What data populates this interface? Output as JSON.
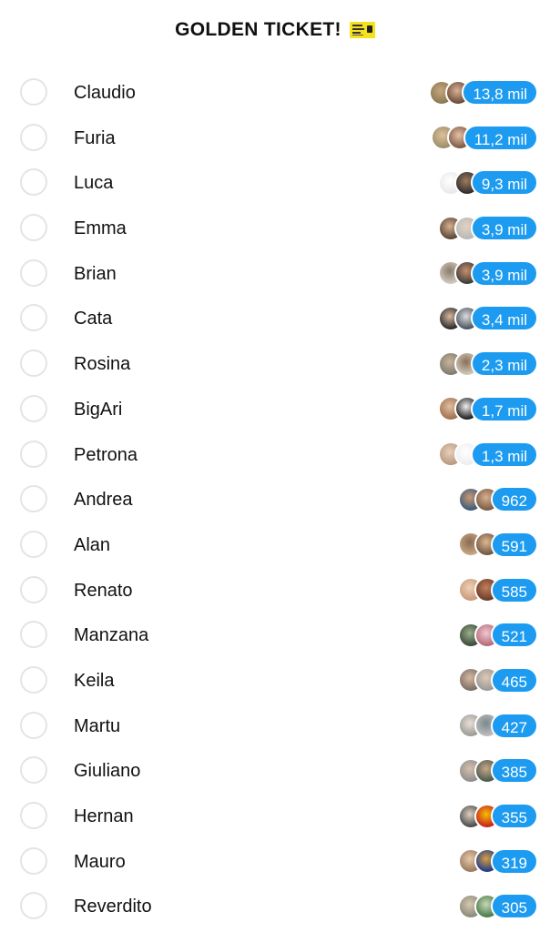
{
  "header": {
    "title": "GOLDEN TICKET!",
    "icon": "golden-ticket-icon"
  },
  "colors": {
    "accent": "#1c9bf0",
    "radio_border": "#e4e4e6",
    "ticket_yellow": "#f6e21c"
  },
  "options": [
    {
      "name": "Claudio",
      "count": "13,8 mil",
      "avatars": [
        [
          "#8a7a55",
          "#c8a67c"
        ],
        [
          "#6b4a3a",
          "#d9b296"
        ]
      ]
    },
    {
      "name": "Furia",
      "count": "11,2 mil",
      "avatars": [
        [
          "#9a8f6a",
          "#e0c09a"
        ],
        [
          "#7b5a47",
          "#e8c2a4"
        ]
      ]
    },
    {
      "name": "Luca",
      "count": "9,3 mil",
      "avatars": [
        [
          "#e9e9e9",
          "#ffffff"
        ],
        [
          "#2e2e2e",
          "#a07c5e"
        ]
      ]
    },
    {
      "name": "Emma",
      "count": "3,9 mil",
      "avatars": [
        [
          "#5a4636",
          "#d6b091"
        ],
        [
          "#b9b9b9",
          "#e3d2c2"
        ]
      ]
    },
    {
      "name": "Brian",
      "count": "3,9 mil",
      "avatars": [
        [
          "#cfcac2",
          "#8c7a66"
        ],
        [
          "#3c3c3c",
          "#c98f6c"
        ]
      ]
    },
    {
      "name": "Cata",
      "count": "3,4 mil",
      "avatars": [
        [
          "#2a2a2a",
          "#d9b8a0"
        ],
        [
          "#4a5560",
          "#dcdcdc"
        ]
      ]
    },
    {
      "name": "Rosina",
      "count": "2,3 mil",
      "avatars": [
        [
          "#7d7d6e",
          "#c9b49c"
        ],
        [
          "#d0c9bd",
          "#8a6e55"
        ]
      ]
    },
    {
      "name": "BigAri",
      "count": "1,7 mil",
      "avatars": [
        [
          "#a07050",
          "#e0c0a0"
        ],
        [
          "#1e1e1e",
          "#f0f0f0"
        ]
      ]
    },
    {
      "name": "Petrona",
      "count": "1,3 mil",
      "avatars": [
        [
          "#b89a80",
          "#e8d0bc"
        ],
        [
          "#eeeeee",
          "#ffffff"
        ]
      ]
    },
    {
      "name": "Andrea",
      "count": "962",
      "avatars": [
        [
          "#3d5a7a",
          "#c89a74"
        ],
        [
          "#7a5b44",
          "#d8b090"
        ]
      ]
    },
    {
      "name": "Alan",
      "count": "591",
      "avatars": [
        [
          "#c7a585",
          "#8a6a4e"
        ],
        [
          "#6e5644",
          "#e0b890"
        ]
      ]
    },
    {
      "name": "Renato",
      "count": "585",
      "avatars": [
        [
          "#c99a7a",
          "#f0d0b8"
        ],
        [
          "#6b3c28",
          "#c0805c"
        ]
      ]
    },
    {
      "name": "Manzana",
      "count": "521",
      "avatars": [
        [
          "#3b4a3a",
          "#9ab08a"
        ],
        [
          "#b56a78",
          "#f0c8d0"
        ]
      ]
    },
    {
      "name": "Keila",
      "count": "465",
      "avatars": [
        [
          "#7a6e66",
          "#d8b8a0"
        ],
        [
          "#9a9a9a",
          "#e0c8b4"
        ]
      ]
    },
    {
      "name": "Martu",
      "count": "427",
      "avatars": [
        [
          "#9b9b95",
          "#e8e0d8"
        ],
        [
          "#bcbcbc",
          "#7a8a8c"
        ]
      ]
    },
    {
      "name": "Giuliano",
      "count": "385",
      "avatars": [
        [
          "#8e8e8e",
          "#d6c0ac"
        ],
        [
          "#4c5a4e",
          "#c8a888"
        ]
      ]
    },
    {
      "name": "Hernan",
      "count": "355",
      "avatars": [
        [
          "#4a4a4a",
          "#e0d0c0"
        ],
        [
          "#c82020",
          "#f5c000"
        ]
      ]
    },
    {
      "name": "Mauro",
      "count": "319",
      "avatars": [
        [
          "#9a7a60",
          "#e8c8a8"
        ],
        [
          "#1f3c8a",
          "#d8a040"
        ]
      ]
    },
    {
      "name": "Reverdito",
      "count": "305",
      "avatars": [
        [
          "#8a8a7a",
          "#d8c8b0"
        ],
        [
          "#4a7a4a",
          "#c8d8b8"
        ]
      ]
    }
  ]
}
